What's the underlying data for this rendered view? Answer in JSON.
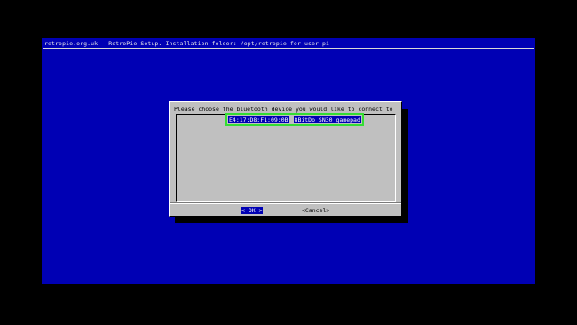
{
  "backtitle": "retropie.org.uk - RetroPie Setup. Installation folder: /opt/retropie for user pi",
  "dialog": {
    "prompt": "Please choose the bluetooth device you would like to connect to",
    "menu_items": [
      {
        "tag": "E4:17:D8:F1:09:0B",
        "description": "8BitDo SN30 gamepad",
        "selected": true
      }
    ],
    "ok_label": "< OK >",
    "cancel_label": "<Cancel>"
  },
  "colors": {
    "screen_background": "#0000b4",
    "dialog_background": "#c0c0c0",
    "highlight": "#33dd33"
  }
}
